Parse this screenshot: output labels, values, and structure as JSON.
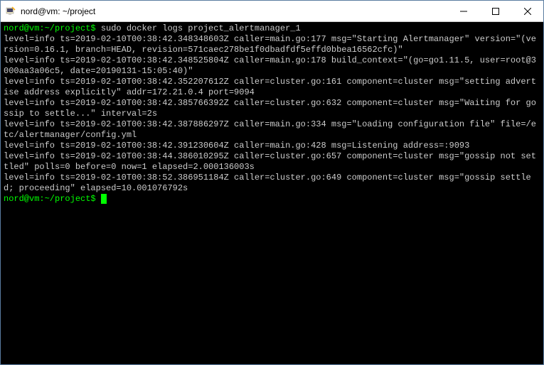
{
  "titlebar": {
    "title": "nord@vm: ~/project"
  },
  "terminal": {
    "prompt1": "nord@vm:~/project$",
    "command1": "sudo docker logs project_alertmanager_1",
    "line1": "level=info ts=2019-02-10T00:38:42.348348603Z caller=main.go:177 msg=\"Starting Alertmanager\" version=\"(version=0.16.1, branch=HEAD, revision=571caec278be1f0dbadfdf5effd0bbea16562cfc)\"",
    "line2": "level=info ts=2019-02-10T00:38:42.348525804Z caller=main.go:178 build_context=\"(go=go1.11.5, user=root@3000aa3a06c5, date=20190131-15:05:40)\"",
    "line3": "level=info ts=2019-02-10T00:38:42.352207612Z caller=cluster.go:161 component=cluster msg=\"setting advertise address explicitly\" addr=172.21.0.4 port=9094",
    "line4": "level=info ts=2019-02-10T00:38:42.385766392Z caller=cluster.go:632 component=cluster msg=\"Waiting for gossip to settle...\" interval=2s",
    "line5": "level=info ts=2019-02-10T00:38:42.387886297Z caller=main.go:334 msg=\"Loading configuration file\" file=/etc/alertmanager/config.yml",
    "line6": "level=info ts=2019-02-10T00:38:42.391230604Z caller=main.go:428 msg=Listening address=:9093",
    "line7": "level=info ts=2019-02-10T00:38:44.386010295Z caller=cluster.go:657 component=cluster msg=\"gossip not settled\" polls=0 before=0 now=1 elapsed=2.000136003s",
    "line8": "level=info ts=2019-02-10T00:38:52.386951184Z caller=cluster.go:649 component=cluster msg=\"gossip settled; proceeding\" elapsed=10.001076792s",
    "prompt2": "nord@vm:~/project$"
  }
}
